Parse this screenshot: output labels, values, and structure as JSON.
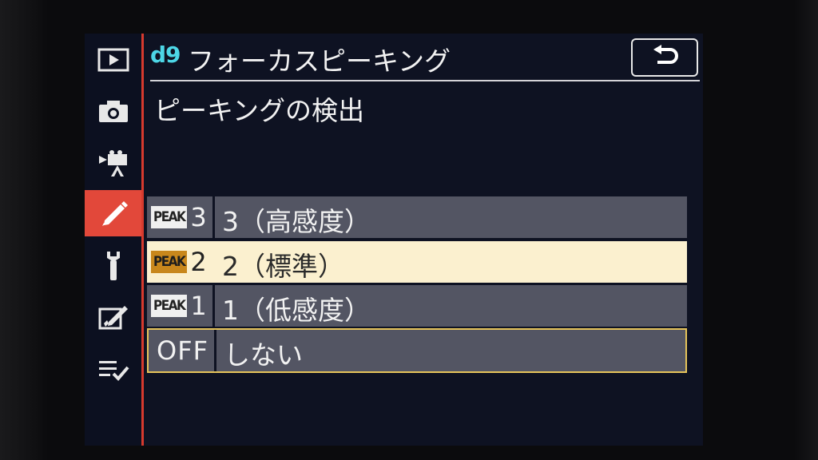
{
  "header": {
    "menu_code": "d9",
    "title": "フォーカスピーキング",
    "back_icon": "return-icon"
  },
  "subtitle": "ピーキングの検出",
  "sidebar": {
    "items": [
      {
        "name": "playback-menu",
        "icon": "play-icon"
      },
      {
        "name": "photo-shooting-menu",
        "icon": "camera-icon"
      },
      {
        "name": "movie-shooting-menu",
        "icon": "movie-camera-icon"
      },
      {
        "name": "custom-settings-menu",
        "icon": "pencil-icon",
        "active": true
      },
      {
        "name": "setup-menu",
        "icon": "wrench-icon"
      },
      {
        "name": "retouch-menu",
        "icon": "retouch-icon"
      },
      {
        "name": "my-menu",
        "icon": "my-menu-icon"
      }
    ]
  },
  "options": [
    {
      "badge": "PEAK",
      "num": "3",
      "label": "3（高感度）"
    },
    {
      "badge": "PEAK",
      "num": "2",
      "label": "2（標準）",
      "selected": true
    },
    {
      "badge": "PEAK",
      "num": "1",
      "label": "1（低感度）"
    },
    {
      "prefix": "OFF",
      "label": "しない",
      "current": true
    }
  ],
  "colors": {
    "accent_red": "#e2483a",
    "code_cyan": "#4dd6e6",
    "selected_bg": "#fbf0cf",
    "current_border": "#e6c45a",
    "option_bg": "#535563"
  }
}
